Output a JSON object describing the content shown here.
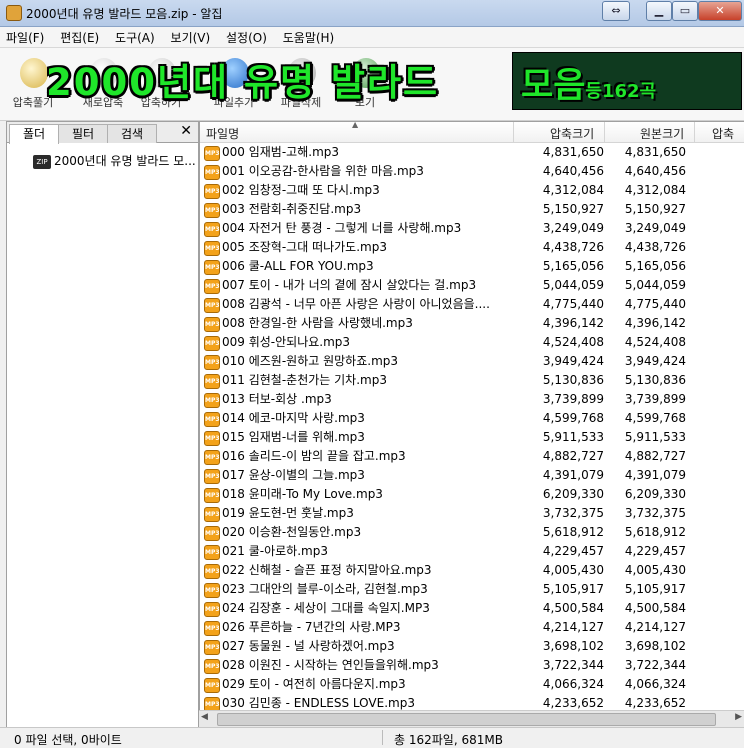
{
  "window": {
    "title": "2000년대 유명 발라드 모음.zip - 알집"
  },
  "menu": [
    "파일(F)",
    "편집(E)",
    "도구(A)",
    "보기(V)",
    "설정(O)",
    "도움말(H)"
  ],
  "toolbar": {
    "buttons": [
      "압축풀기",
      "새로압축",
      "압축하기",
      "파일추가",
      "파일삭제",
      "보기"
    ]
  },
  "banner": {
    "text": "2000년대 유명 발라드",
    "text2": "모음",
    "text3": "등162곡"
  },
  "left": {
    "tabs": [
      "폴더",
      "필터",
      "검색"
    ],
    "tree_item": "2000년대 유명 발라드 모..."
  },
  "columns": [
    "파일명",
    "압축크기",
    "원본크기",
    "압축"
  ],
  "files": [
    {
      "name": "000 임재범-고해.mp3",
      "packed": "4,831,650",
      "orig": "4,831,650"
    },
    {
      "name": "001 이오공감-한사람을 위한 마음.mp3",
      "packed": "4,640,456",
      "orig": "4,640,456"
    },
    {
      "name": "002 임창정-그때 또 다시.mp3",
      "packed": "4,312,084",
      "orig": "4,312,084"
    },
    {
      "name": "003 전람회-취중진담.mp3",
      "packed": "5,150,927",
      "orig": "5,150,927"
    },
    {
      "name": "004 자전거 탄 풍경 - 그렇게 너를 사랑해.mp3",
      "packed": "3,249,049",
      "orig": "3,249,049"
    },
    {
      "name": "005 조장혁-그대 떠나가도.mp3",
      "packed": "4,438,726",
      "orig": "4,438,726"
    },
    {
      "name": "006 쿨-ALL FOR YOU.mp3",
      "packed": "5,165,056",
      "orig": "5,165,056"
    },
    {
      "name": "007 토이 - 내가 너의 곁에 잠시 살았다는 걸.mp3",
      "packed": "5,044,059",
      "orig": "5,044,059"
    },
    {
      "name": "008 김광석 - 너무 아픈 사랑은 사랑이 아니었음을....",
      "packed": "4,775,440",
      "orig": "4,775,440"
    },
    {
      "name": "008 한경일-한 사람을 사랑했네.mp3",
      "packed": "4,396,142",
      "orig": "4,396,142"
    },
    {
      "name": "009 휘성-안되나요.mp3",
      "packed": "4,524,408",
      "orig": "4,524,408"
    },
    {
      "name": "010 에즈원-원하고 원망하죠.mp3",
      "packed": "3,949,424",
      "orig": "3,949,424"
    },
    {
      "name": "011 김현철-춘천가는 기차.mp3",
      "packed": "5,130,836",
      "orig": "5,130,836"
    },
    {
      "name": "013 터보-회상 .mp3",
      "packed": "3,739,899",
      "orig": "3,739,899"
    },
    {
      "name": "014 에코-마지막 사랑.mp3",
      "packed": "4,599,768",
      "orig": "4,599,768"
    },
    {
      "name": "015 임재범-너를 위해.mp3",
      "packed": "5,911,533",
      "orig": "5,911,533"
    },
    {
      "name": "016 솔리드-이 밤의 끝을 잡고.mp3",
      "packed": "4,882,727",
      "orig": "4,882,727"
    },
    {
      "name": "017 윤상-이별의 그늘.mp3",
      "packed": "4,391,079",
      "orig": "4,391,079"
    },
    {
      "name": "018 윤미래-To My Love.mp3",
      "packed": "6,209,330",
      "orig": "6,209,330"
    },
    {
      "name": "019 윤도현-먼 훗날.mp3",
      "packed": "3,732,375",
      "orig": "3,732,375"
    },
    {
      "name": "020 이승환-천일동안.mp3",
      "packed": "5,618,912",
      "orig": "5,618,912"
    },
    {
      "name": "021 쿨-아로하.mp3",
      "packed": "4,229,457",
      "orig": "4,229,457"
    },
    {
      "name": "022 신해철 - 슬픈 표정 하지말아요.mp3",
      "packed": "4,005,430",
      "orig": "4,005,430"
    },
    {
      "name": "023 그대안의 블루-이소라, 김현철.mp3",
      "packed": "5,105,917",
      "orig": "5,105,917"
    },
    {
      "name": "024 김장훈 - 세상이 그대를 속일지.MP3",
      "packed": "4,500,584",
      "orig": "4,500,584"
    },
    {
      "name": "026 푸른하늘 - 7년간의 사랑.MP3",
      "packed": "4,214,127",
      "orig": "4,214,127"
    },
    {
      "name": "027 동물원 - 널 사랑하겠어.mp3",
      "packed": "3,698,102",
      "orig": "3,698,102"
    },
    {
      "name": "028 이원진 - 시작하는 연인들을위해.mp3",
      "packed": "3,722,344",
      "orig": "3,722,344"
    },
    {
      "name": "029 토이 - 여전히 아름다운지.mp3",
      "packed": "4,066,324",
      "orig": "4,066,324"
    },
    {
      "name": "030 김민종 - ENDLESS LOVE.mp3",
      "packed": "4,233,652",
      "orig": "4,233,652"
    }
  ],
  "status": {
    "selection": "0 파일 선택,  0바이트",
    "total": "총 162파일,  681MB"
  },
  "colors": {
    "banner_green": "#1fe62a",
    "mp3_orange": "#f3a21a"
  }
}
